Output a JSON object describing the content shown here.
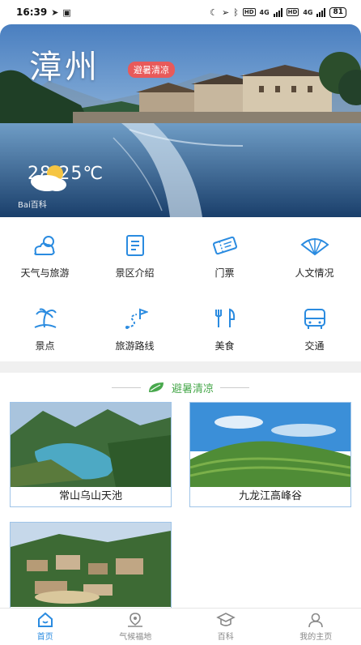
{
  "status_bar": {
    "time": "16:39",
    "network_1": "4G",
    "network_2": "4G",
    "battery": "81"
  },
  "hero": {
    "city": "漳州",
    "badge": "避暑清凉",
    "temperature": "28/25℃",
    "weather_icon": "partly-cloudy-icon",
    "source": "Bai百科"
  },
  "features": [
    {
      "label": "天气与旅游",
      "icon": "weather-travel-icon"
    },
    {
      "label": "景区介绍",
      "icon": "scenic-intro-icon"
    },
    {
      "label": "门票",
      "icon": "ticket-icon"
    },
    {
      "label": "人文情况",
      "icon": "culture-fan-icon"
    },
    {
      "label": "景点",
      "icon": "palm-attraction-icon"
    },
    {
      "label": "旅游路线",
      "icon": "route-flag-icon"
    },
    {
      "label": "美食",
      "icon": "food-utensils-icon"
    },
    {
      "label": "交通",
      "icon": "bus-icon"
    }
  ],
  "section": {
    "title": "避暑清凉"
  },
  "spots": [
    {
      "name": "常山乌山天池"
    },
    {
      "name": "九龙江高峰谷"
    },
    {
      "name": ""
    }
  ],
  "bottom_nav": [
    {
      "label": "首页",
      "icon": "home-icon",
      "active": true
    },
    {
      "label": "气候福地",
      "icon": "map-pin-icon",
      "active": false
    },
    {
      "label": "百科",
      "icon": "graduation-cap-icon",
      "active": false
    },
    {
      "label": "我的主页",
      "icon": "user-icon",
      "active": false
    }
  ],
  "colors": {
    "accent": "#2a8be0",
    "badge": "#e85a5a",
    "section_green": "#48a84c",
    "card_border": "#9fc4e8"
  }
}
